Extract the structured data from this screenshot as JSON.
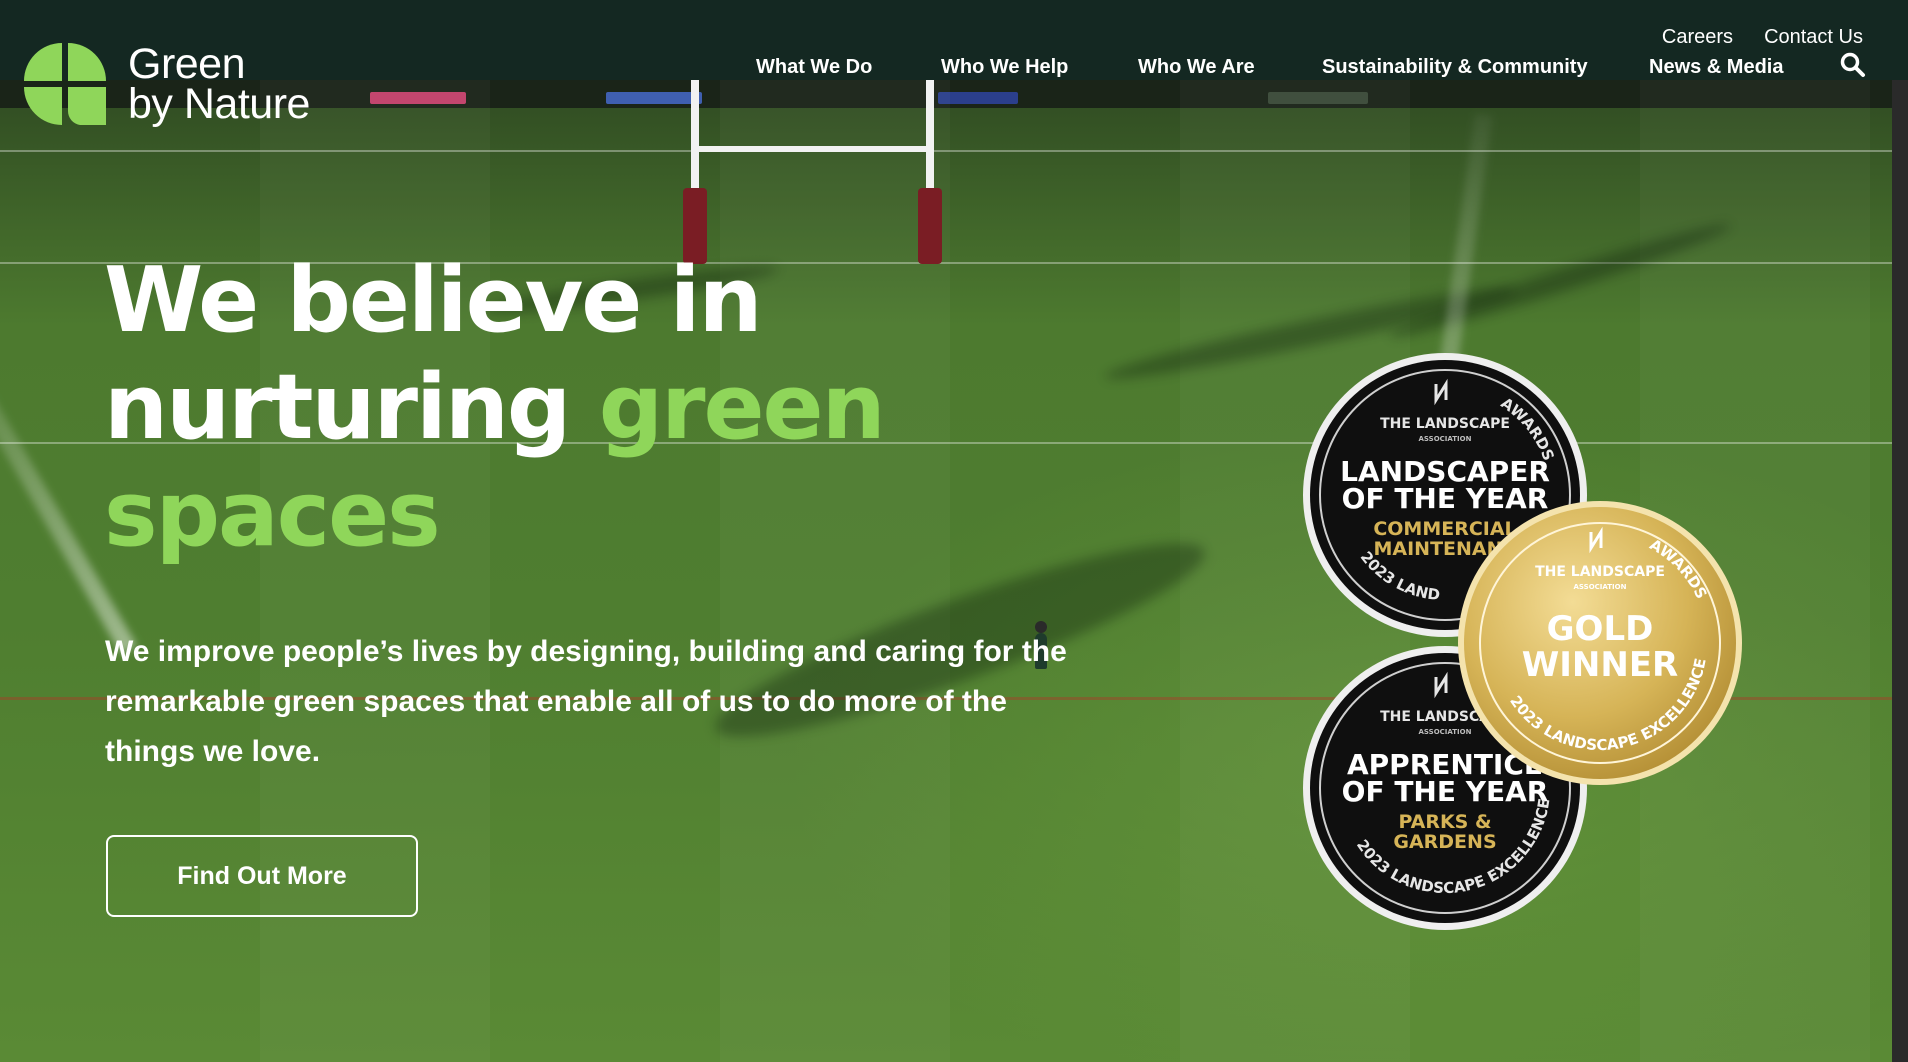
{
  "topbar": {
    "links": [
      "Careers",
      "Contact Us"
    ]
  },
  "brand": {
    "line1": "Green",
    "line2": "by Nature",
    "accent": "#8fd65a"
  },
  "nav": {
    "items": [
      "What We Do",
      "Who We Help",
      "Who We Are",
      "Sustainability & Community",
      "News & Media"
    ],
    "search_icon": "search-icon"
  },
  "hero": {
    "headline_line1": "We believe in",
    "headline_line2_a": "nurturing ",
    "headline_line2_b": "green",
    "headline_line3": "spaces",
    "subtext": "We improve people’s lives by designing, building and caring for the remarkable green spaces that enable all of us to do more of the things we love.",
    "cta_label": "Find Out More"
  },
  "badges": {
    "association": "THE LANDSCAPE",
    "association_sub": "ASSOCIATION",
    "awards": "AWARDS",
    "landscaper": {
      "title1": "LANDSCAPER",
      "title2": "OF THE YEAR",
      "cat1": "COMMERCIAL",
      "cat2": "MAINTENANC",
      "year": "2023 LAND"
    },
    "apprentice": {
      "title1": "APPRENTICE",
      "title2": "OF THE YEAR",
      "cat1": "PARKS &",
      "cat2": "GARDENS",
      "year": "2023 LANDSCAPE EXCELLENCE"
    },
    "gold": {
      "title1": "GOLD",
      "title2": "WINNER",
      "year": "2023 LANDSCAPE EXCELLENCE",
      "awards": "AWARDS"
    }
  },
  "colors": {
    "topbar": "#142822",
    "headline_green": "#8fd65a",
    "gold": "#d6b457"
  }
}
